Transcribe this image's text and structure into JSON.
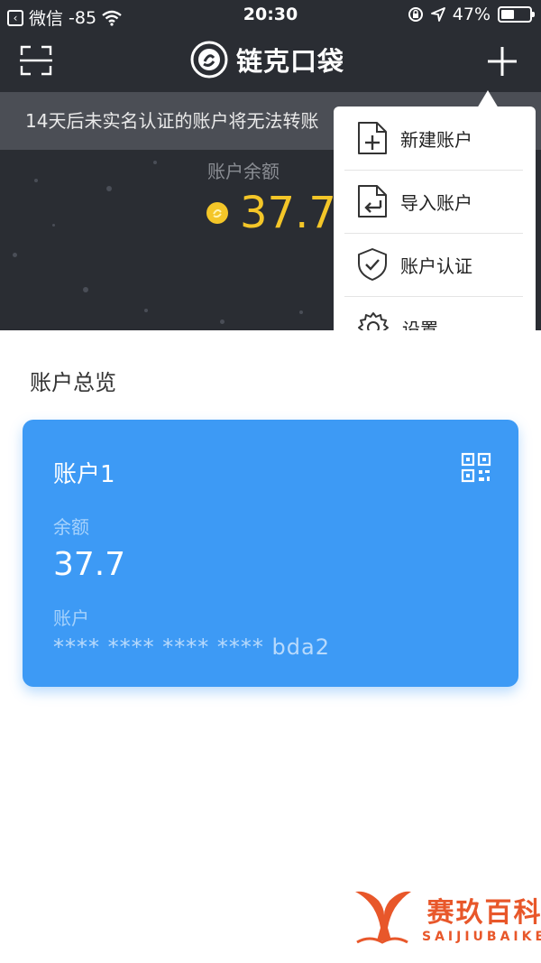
{
  "status_bar": {
    "carrier": "微信",
    "signal": "-85",
    "time": "20:30",
    "battery": "47%",
    "battery_level": 0.47
  },
  "header": {
    "app_title": "链克口袋"
  },
  "banner": {
    "text": "14天后未实名认证的账户将无法转账"
  },
  "balance": {
    "label": "账户余额",
    "value": "37.7"
  },
  "menu": {
    "items": [
      {
        "label": "新建账户",
        "icon": "file-add-icon"
      },
      {
        "label": "导入账户",
        "icon": "file-import-icon"
      },
      {
        "label": "账户认证",
        "icon": "shield-check-icon"
      },
      {
        "label": "设置",
        "icon": "gear-icon"
      }
    ]
  },
  "overview": {
    "title": "账户总览",
    "card": {
      "name": "账户1",
      "balance_caption": "余额",
      "balance": "37.7",
      "account_caption": "账户",
      "account_number": "**** **** **** **** bda2"
    }
  },
  "watermark": {
    "cn": "赛玖百科",
    "en": "SAIJIUBAIKE"
  },
  "colors": {
    "dark_bg": "#2a2d33",
    "banner_bg": "#4b4e55",
    "coin": "#f4c628",
    "card": "#3d9af5",
    "watermark": "#e8572a"
  }
}
